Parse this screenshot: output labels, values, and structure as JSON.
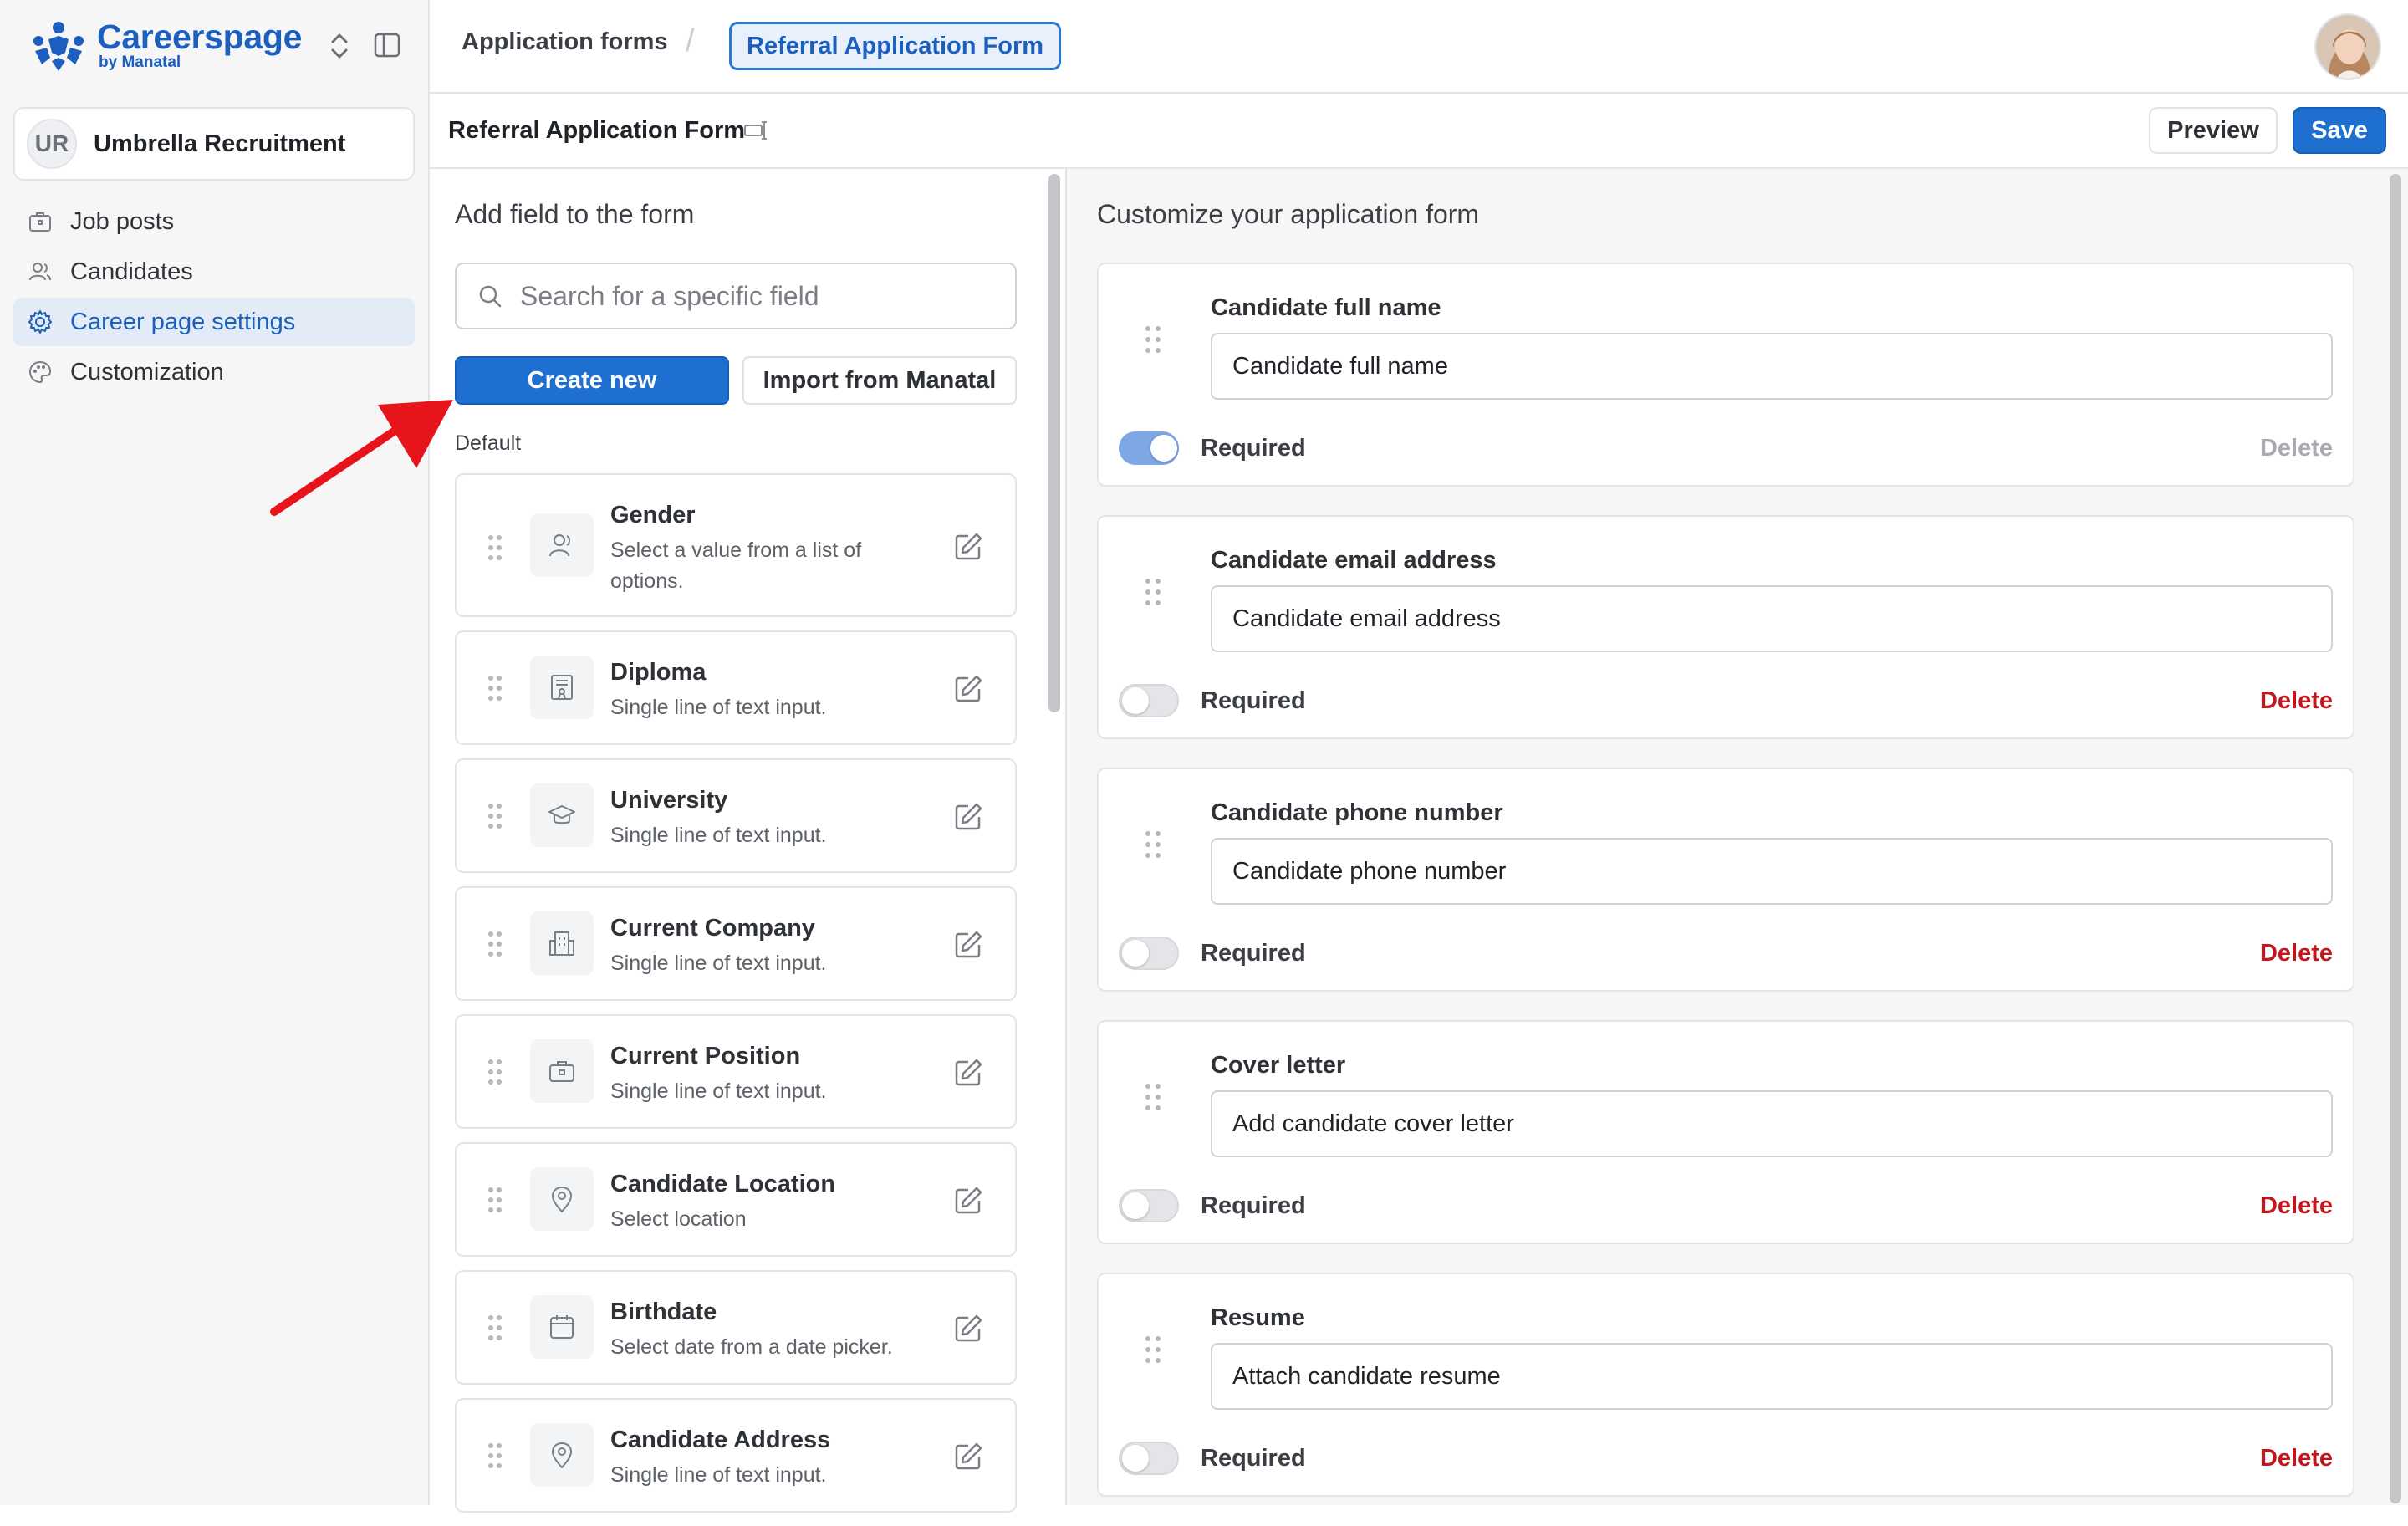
{
  "app": {
    "brand_name": "Careerspage",
    "brand_sub": "by Manatal",
    "brand_color": "#1c5fbf"
  },
  "org": {
    "initials": "UR",
    "name": "Umbrella Recruitment"
  },
  "nav": {
    "items": [
      {
        "label": "Job posts",
        "icon": "briefcase-icon"
      },
      {
        "label": "Candidates",
        "icon": "users-icon"
      },
      {
        "label": "Career page settings",
        "icon": "gear-icon",
        "active": true
      },
      {
        "label": "Customization",
        "icon": "palette-icon"
      }
    ]
  },
  "breadcrumb": {
    "parent": "Application forms",
    "separator": "/",
    "current": "Referral Application Form"
  },
  "toolbar": {
    "form_title": "Referral Application Form",
    "preview_label": "Preview",
    "save_label": "Save"
  },
  "left": {
    "title": "Add field to the form",
    "search_placeholder": "Search for a specific field",
    "create_label": "Create new",
    "import_label": "Import from Manatal",
    "section_label": "Default",
    "fields": [
      {
        "name": "Gender",
        "desc": "Select a value from a list of options.",
        "icon": "person-icon"
      },
      {
        "name": "Diploma",
        "desc": "Single line of text input.",
        "icon": "certificate-icon"
      },
      {
        "name": "University",
        "desc": "Single line of text input.",
        "icon": "graduation-cap-icon"
      },
      {
        "name": "Current Company",
        "desc": "Single line of text input.",
        "icon": "building-icon"
      },
      {
        "name": "Current Position",
        "desc": "Single line of text input.",
        "icon": "briefcase-icon"
      },
      {
        "name": "Candidate Location",
        "desc": "Select location",
        "icon": "location-pin-icon"
      },
      {
        "name": "Birthdate",
        "desc": "Select date from a date picker.",
        "icon": "calendar-icon"
      },
      {
        "name": "Candidate Address",
        "desc": "Single line of text input.",
        "icon": "location-pin-icon"
      }
    ]
  },
  "right": {
    "title": "Customize your application form",
    "required_label": "Required",
    "delete_label": "Delete",
    "fields": [
      {
        "label": "Candidate full name",
        "value": "Candidate full name",
        "required": true,
        "delete_enabled": false
      },
      {
        "label": "Candidate email address",
        "value": "Candidate email address",
        "required": false,
        "delete_enabled": true
      },
      {
        "label": "Candidate phone number",
        "value": "Candidate phone number",
        "required": false,
        "delete_enabled": true
      },
      {
        "label": "Cover letter",
        "value": "Add candidate cover letter",
        "required": false,
        "delete_enabled": true
      },
      {
        "label": "Resume",
        "value": "Attach candidate resume",
        "required": false,
        "delete_enabled": true
      }
    ]
  },
  "colors": {
    "primary": "#1f6fd1",
    "delete": "#c3161c",
    "annotation_arrow": "#e8141b"
  }
}
